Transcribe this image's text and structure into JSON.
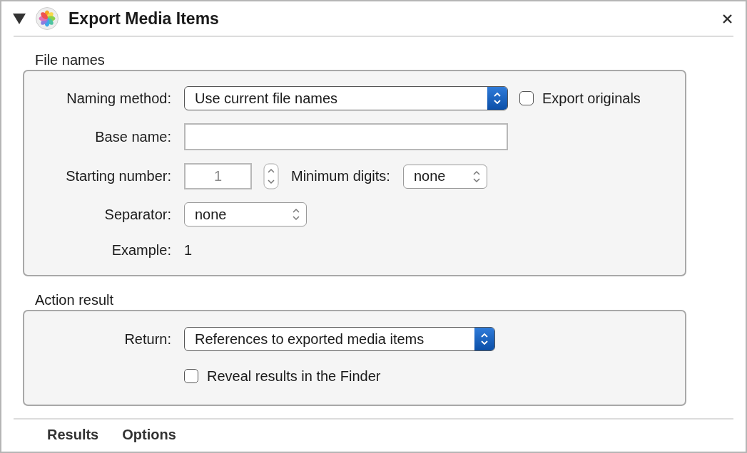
{
  "header": {
    "title": "Export Media Items",
    "expanded": true
  },
  "file_names": {
    "heading": "File names",
    "naming_method": {
      "label": "Naming method:",
      "value": "Use current file names",
      "kind": "accent"
    },
    "export_originals": {
      "label": "Export originals",
      "checked": false
    },
    "base_name": {
      "label": "Base name:"
    },
    "starting_number": {
      "label": "Starting number:",
      "value": "1",
      "disabled": true
    },
    "minimum_digits": {
      "label": "Minimum digits:",
      "value": "none",
      "kind": "plain"
    },
    "separator": {
      "label": "Separator:",
      "value": "none",
      "kind": "plain"
    },
    "example": {
      "label": "Example:",
      "value": "1"
    }
  },
  "action_result": {
    "heading": "Action result",
    "return": {
      "label": "Return:",
      "value": "References to exported media items",
      "kind": "accent"
    },
    "reveal": {
      "label": "Reveal results in the Finder",
      "checked": false
    }
  },
  "footer_tabs": [
    {
      "label": "Results"
    },
    {
      "label": "Options"
    }
  ]
}
